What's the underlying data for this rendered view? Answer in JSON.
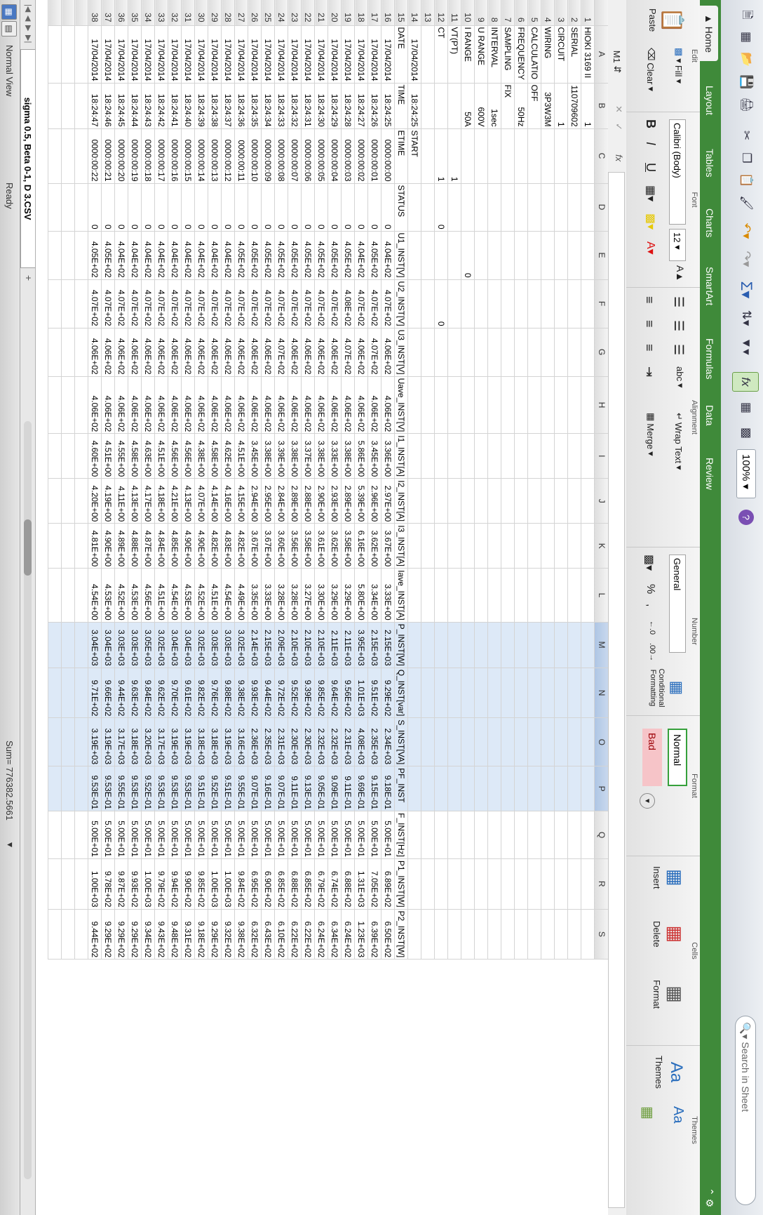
{
  "toolbar": {
    "font_name": "Calibri (Body)",
    "font_size": "12",
    "zoom": "100%",
    "search_placeholder": "Search in Sheet"
  },
  "tabs": [
    "Home",
    "Layout",
    "Tables",
    "Charts",
    "SmartArt",
    "Formulas",
    "Data",
    "Review"
  ],
  "ribbon": {
    "edit": {
      "label": "Edit",
      "paste": "Paste",
      "fill": "Fill",
      "clear": "Clear"
    },
    "font": {
      "label": "Font",
      "name": "Calibri (Body)",
      "size": "12"
    },
    "alignment": {
      "label": "Alignment",
      "wrap": "Wrap Text",
      "merge": "Merge",
      "abc": "abc"
    },
    "number": {
      "label": "Number",
      "format": "General",
      "conditional": "Conditional Formatting"
    },
    "format": {
      "label": "Format",
      "normal": "Normal",
      "bad": "Bad"
    },
    "cells": {
      "label": "Cells",
      "insert": "Insert",
      "delete": "Delete",
      "format": "Format"
    },
    "themes": {
      "label": "Themes",
      "themes": "Themes",
      "aa": "Aa"
    }
  },
  "formula_bar": {
    "name_box": "M1",
    "fx": "fx"
  },
  "columns": [
    "A",
    "B",
    "C",
    "D",
    "E",
    "F",
    "G",
    "H",
    "I",
    "J",
    "K",
    "L",
    "M",
    "N",
    "O",
    "P",
    "Q",
    "R",
    "S"
  ],
  "selected_columns": [
    "M",
    "N",
    "O",
    "P"
  ],
  "rows": [
    [
      "HIOKI 3169 II",
      "1",
      "",
      "",
      "",
      "",
      "",
      "",
      "",
      "",
      "",
      "",
      "",
      "",
      "",
      "",
      "",
      "",
      ""
    ],
    [
      "SERIAL",
      "110709602",
      "",
      "",
      "",
      "",
      "",
      "",
      "",
      "",
      "",
      "",
      "",
      "",
      "",
      "",
      "",
      "",
      ""
    ],
    [
      "CIRCUIT",
      "1",
      "",
      "",
      "",
      "",
      "",
      "",
      "",
      "",
      "",
      "",
      "",
      "",
      "",
      "",
      "",
      "",
      ""
    ],
    [
      "WIRING",
      "3P3W3M",
      "",
      "",
      "",
      "",
      "",
      "",
      "",
      "",
      "",
      "",
      "",
      "",
      "",
      "",
      "",
      "",
      ""
    ],
    [
      "CALCULATIO",
      "OFF",
      "",
      "",
      "",
      "",
      "",
      "",
      "",
      "",
      "",
      "",
      "",
      "",
      "",
      "",
      "",
      "",
      ""
    ],
    [
      "FREQUENCY",
      "50Hz",
      "",
      "",
      "",
      "",
      "",
      "",
      "",
      "",
      "",
      "",
      "",
      "",
      "",
      "",
      "",
      "",
      ""
    ],
    [
      "SAMPLING",
      "FIX",
      "",
      "",
      "",
      "",
      "",
      "",
      "",
      "",
      "",
      "",
      "",
      "",
      "",
      "",
      "",
      "",
      ""
    ],
    [
      "INTERVAL",
      "1sec",
      "",
      "",
      "",
      "",
      "",
      "",
      "",
      "",
      "",
      "",
      "",
      "",
      "",
      "",
      "",
      "",
      ""
    ],
    [
      "U RANGE",
      "600V",
      "",
      "",
      "",
      "",
      "",
      "",
      "",
      "",
      "",
      "",
      "",
      "",
      "",
      "",
      "",
      "",
      ""
    ],
    [
      "I RANGE",
      "50A",
      "",
      "",
      "0",
      "",
      "",
      "",
      "",
      "",
      "",
      "",
      "",
      "",
      "",
      "",
      "",
      "",
      ""
    ],
    [
      "VT(PT)",
      "",
      "1",
      "",
      "",
      "",
      "",
      "",
      "",
      "",
      "",
      "",
      "",
      "",
      "",
      "",
      "",
      "",
      ""
    ],
    [
      "CT",
      "",
      "1",
      "0",
      "",
      "0",
      "",
      "",
      "",
      "",
      "",
      "",
      "",
      "",
      "",
      "",
      "",
      "",
      ""
    ],
    [
      "",
      "",
      "",
      "",
      "",
      "",
      "",
      "",
      "",
      "",
      "",
      "",
      "",
      "",
      "",
      "",
      "",
      "",
      ""
    ],
    [
      "17/04/2014",
      "18:24:25",
      "START",
      "",
      "",
      "",
      "",
      "",
      "",
      "",
      "",
      "",
      "",
      "",
      "",
      "",
      "",
      "",
      ""
    ],
    [
      "DATE",
      "TIME",
      "ETIME",
      "STATUS",
      "U1_INST[V]",
      "U2_INST[V]",
      "U3_INST[V]",
      "Uave_INST[V]",
      "I1_INST[A]",
      "I2_INST[A]",
      "I3_INST[A]",
      "Iave_INST[A]",
      "P_INST[W]",
      "Q_INST[var]",
      "S_INST[VA]",
      "PF_INST",
      "F_INST[Hz]",
      "P1_INST[W]",
      "P2_INST[W]"
    ],
    [
      "17/04/2014",
      "18:24:25",
      "0000:00:00",
      "0",
      "4.04E+02",
      "4.07E+02",
      "4.06E+02",
      "4.06E+02",
      "3.36E+00",
      "2.97E+00",
      "3.67E+00",
      "3.33E+00",
      "2.15E+03",
      "9.29E+02",
      "2.34E+03",
      "9.18E-01",
      "5.00E+01",
      "6.89E+02",
      "6.50E+02"
    ],
    [
      "17/04/2014",
      "18:24:26",
      "0000:00:01",
      "0",
      "4.05E+02",
      "4.07E+02",
      "4.07E+02",
      "4.06E+02",
      "3.45E+00",
      "2.96E+00",
      "3.62E+00",
      "3.34E+00",
      "2.15E+03",
      "9.51E+02",
      "2.35E+03",
      "9.15E-01",
      "5.00E+01",
      "7.05E+02",
      "6.39E+02"
    ],
    [
      "17/04/2014",
      "18:24:27",
      "0000:00:02",
      "0",
      "4.04E+02",
      "4.07E+02",
      "4.06E+02",
      "4.06E+02",
      "5.86E+00",
      "5.39E+00",
      "6.16E+00",
      "5.80E+00",
      "3.95E+03",
      "1.01E+03",
      "4.08E+03",
      "9.69E-01",
      "5.00E+01",
      "1.31E+03",
      "1.23E+03"
    ],
    [
      "17/04/2014",
      "18:24:28",
      "0000:00:03",
      "0",
      "4.05E+02",
      "4.08E+02",
      "4.07E+02",
      "4.06E+02",
      "3.38E+00",
      "2.89E+00",
      "3.58E+00",
      "3.29E+00",
      "2.11E+03",
      "9.56E+02",
      "2.31E+03",
      "9.11E-01",
      "5.00E+01",
      "6.88E+02",
      "6.24E+02"
    ],
    [
      "17/04/2014",
      "18:24:29",
      "0000:00:04",
      "0",
      "4.05E+02",
      "4.07E+02",
      "4.06E+02",
      "4.06E+02",
      "3.33E+00",
      "2.93E+00",
      "3.62E+00",
      "3.29E+00",
      "2.11E+03",
      "9.64E+02",
      "2.32E+03",
      "9.09E-01",
      "5.00E+01",
      "6.74E+02",
      "6.34E+02"
    ],
    [
      "17/04/2014",
      "18:24:30",
      "0000:00:05",
      "0",
      "4.05E+02",
      "4.07E+02",
      "4.06E+02",
      "4.06E+02",
      "3.38E+00",
      "2.90E+00",
      "3.61E+00",
      "3.30E+00",
      "2.10E+03",
      "9.85E+02",
      "2.32E+03",
      "9.05E-01",
      "5.00E+01",
      "6.79E+02",
      "6.24E+02"
    ],
    [
      "17/04/2014",
      "18:24:31",
      "0000:00:06",
      "0",
      "4.05E+02",
      "4.07E+02",
      "4.06E+02",
      "4.06E+02",
      "3.37E+00",
      "2.88E+00",
      "3.58E+00",
      "3.27E+00",
      "2.10E+03",
      "9.39E+02",
      "2.30E+03",
      "9.13E-01",
      "5.00E+01",
      "6.85E+02",
      "6.22E+02"
    ],
    [
      "17/04/2014",
      "18:24:32",
      "0000:00:07",
      "0",
      "4.05E+02",
      "4.07E+02",
      "4.06E+02",
      "4.06E+02",
      "3.38E+00",
      "2.89E+00",
      "3.56E+00",
      "3.28E+00",
      "2.10E+03",
      "9.52E+02",
      "2.30E+03",
      "9.11E-01",
      "5.00E+01",
      "6.88E+02",
      "6.22E+02"
    ],
    [
      "17/04/2014",
      "18:24:33",
      "0000:00:08",
      "0",
      "4.05E+02",
      "4.07E+02",
      "4.07E+02",
      "4.06E+02",
      "3.39E+00",
      "2.84E+00",
      "3.60E+00",
      "3.28E+00",
      "2.09E+03",
      "9.72E+02",
      "2.31E+03",
      "9.07E-01",
      "5.00E+01",
      "6.85E+02",
      "6.10E+02"
    ],
    [
      "17/04/2014",
      "18:24:34",
      "0000:00:09",
      "0",
      "4.05E+02",
      "4.07E+02",
      "4.06E+02",
      "4.06E+02",
      "3.38E+00",
      "2.95E+00",
      "3.67E+00",
      "3.33E+00",
      "2.15E+03",
      "9.44E+02",
      "2.35E+03",
      "9.16E-01",
      "5.00E+01",
      "6.90E+02",
      "6.43E+02"
    ],
    [
      "17/04/2014",
      "18:24:35",
      "0000:00:10",
      "0",
      "4.05E+02",
      "4.07E+02",
      "4.06E+02",
      "4.06E+02",
      "3.45E+00",
      "2.94E+00",
      "3.67E+00",
      "3.35E+00",
      "2.14E+03",
      "9.93E+02",
      "2.36E+03",
      "9.07E-01",
      "5.00E+01",
      "6.95E+02",
      "6.32E+02"
    ],
    [
      "17/04/2014",
      "18:24:36",
      "0000:00:11",
      "0",
      "4.05E+02",
      "4.07E+02",
      "4.06E+02",
      "4.06E+02",
      "4.51E+00",
      "4.15E+00",
      "4.82E+00",
      "4.49E+00",
      "3.02E+03",
      "9.38E+02",
      "3.16E+03",
      "9.55E-01",
      "5.00E+01",
      "9.84E+02",
      "9.38E+02"
    ],
    [
      "17/04/2014",
      "18:24:37",
      "0000:00:12",
      "0",
      "4.04E+02",
      "4.07E+02",
      "4.06E+02",
      "4.06E+02",
      "4.62E+00",
      "4.16E+00",
      "4.83E+00",
      "4.54E+00",
      "3.03E+03",
      "9.88E+02",
      "3.19E+03",
      "9.51E-01",
      "5.00E+01",
      "1.00E+03",
      "9.32E+02"
    ],
    [
      "17/04/2014",
      "18:24:38",
      "0000:00:13",
      "0",
      "4.04E+02",
      "4.07E+02",
      "4.06E+02",
      "4.06E+02",
      "4.58E+00",
      "4.14E+00",
      "4.82E+00",
      "4.51E+00",
      "3.03E+03",
      "9.76E+02",
      "3.18E+03",
      "9.52E-01",
      "5.00E+01",
      "1.00E+03",
      "9.29E+02"
    ],
    [
      "17/04/2014",
      "18:24:39",
      "0000:00:14",
      "0",
      "4.04E+02",
      "4.07E+02",
      "4.06E+02",
      "4.06E+02",
      "4.38E+00",
      "4.07E+00",
      "4.90E+00",
      "4.52E+00",
      "3.02E+03",
      "9.82E+02",
      "3.18E+03",
      "9.51E-01",
      "5.00E+01",
      "9.85E+02",
      "9.18E+02"
    ],
    [
      "17/04/2014",
      "18:24:40",
      "0000:00:15",
      "0",
      "4.04E+02",
      "4.07E+02",
      "4.06E+02",
      "4.06E+02",
      "4.56E+00",
      "4.13E+00",
      "4.90E+00",
      "4.53E+00",
      "3.04E+03",
      "9.61E+02",
      "3.19E+03",
      "9.53E-01",
      "5.00E+01",
      "9.90E+02",
      "9.31E+02"
    ],
    [
      "17/04/2014",
      "18:24:41",
      "0000:00:16",
      "0",
      "4.04E+02",
      "4.07E+02",
      "4.06E+02",
      "4.06E+02",
      "4.56E+00",
      "4.21E+00",
      "4.85E+00",
      "4.54E+00",
      "3.04E+03",
      "9.70E+02",
      "3.19E+03",
      "9.53E-01",
      "5.00E+01",
      "9.94E+02",
      "9.48E+02"
    ],
    [
      "17/04/2014",
      "18:24:42",
      "0000:00:17",
      "0",
      "4.04E+02",
      "4.07E+02",
      "4.06E+02",
      "4.06E+02",
      "4.51E+00",
      "4.18E+00",
      "4.84E+00",
      "4.51E+00",
      "3.02E+03",
      "9.62E+02",
      "3.17E+03",
      "9.53E-01",
      "5.00E+01",
      "9.79E+02",
      "9.43E+02"
    ],
    [
      "17/04/2014",
      "18:24:43",
      "0000:00:18",
      "0",
      "4.04E+02",
      "4.07E+02",
      "4.06E+02",
      "4.06E+02",
      "4.63E+00",
      "4.17E+00",
      "4.87E+00",
      "4.56E+00",
      "3.05E+03",
      "9.84E+02",
      "3.20E+03",
      "9.52E-01",
      "5.00E+01",
      "1.00E+03",
      "9.34E+02"
    ],
    [
      "17/04/2014",
      "18:24:44",
      "0000:00:19",
      "0",
      "4.04E+02",
      "4.07E+02",
      "4.06E+02",
      "4.06E+02",
      "4.58E+00",
      "4.13E+00",
      "4.88E+00",
      "4.53E+00",
      "3.03E+03",
      "9.63E+02",
      "3.18E+03",
      "9.53E-01",
      "5.00E+01",
      "9.93E+02",
      "9.29E+02"
    ],
    [
      "17/04/2014",
      "18:24:45",
      "0000:00:20",
      "0",
      "4.04E+02",
      "4.07E+02",
      "4.06E+02",
      "4.06E+02",
      "4.55E+00",
      "4.11E+00",
      "4.89E+00",
      "4.52E+00",
      "3.03E+03",
      "9.44E+02",
      "3.17E+03",
      "9.55E-01",
      "5.00E+01",
      "9.87E+02",
      "9.29E+02"
    ],
    [
      "17/04/2014",
      "18:24:46",
      "0000:00:21",
      "0",
      "4.05E+02",
      "4.07E+02",
      "4.06E+02",
      "4.06E+02",
      "4.51E+00",
      "4.19E+00",
      "4.90E+00",
      "4.53E+00",
      "3.04E+03",
      "9.66E+02",
      "3.19E+03",
      "9.53E-01",
      "5.00E+01",
      "9.78E+02",
      "9.29E+02"
    ],
    [
      "17/04/2014",
      "18:24:47",
      "0000:00:22",
      "0",
      "4.05E+02",
      "4.07E+02",
      "4.06E+02",
      "4.06E+02",
      "4.60E+00",
      "4.20E+00",
      "4.81E+00",
      "4.54E+00",
      "3.04E+03",
      "9.71E+02",
      "3.19E+03",
      "9.53E-01",
      "5.00E+01",
      "1.00E+03",
      "9.44E+02"
    ]
  ],
  "sheet_tab": "sigma 0.5, Beta 0-1, D 3.CSV",
  "status": {
    "view": "Normal View",
    "ready": "Ready",
    "sum": "Sum= 776382.5661"
  }
}
